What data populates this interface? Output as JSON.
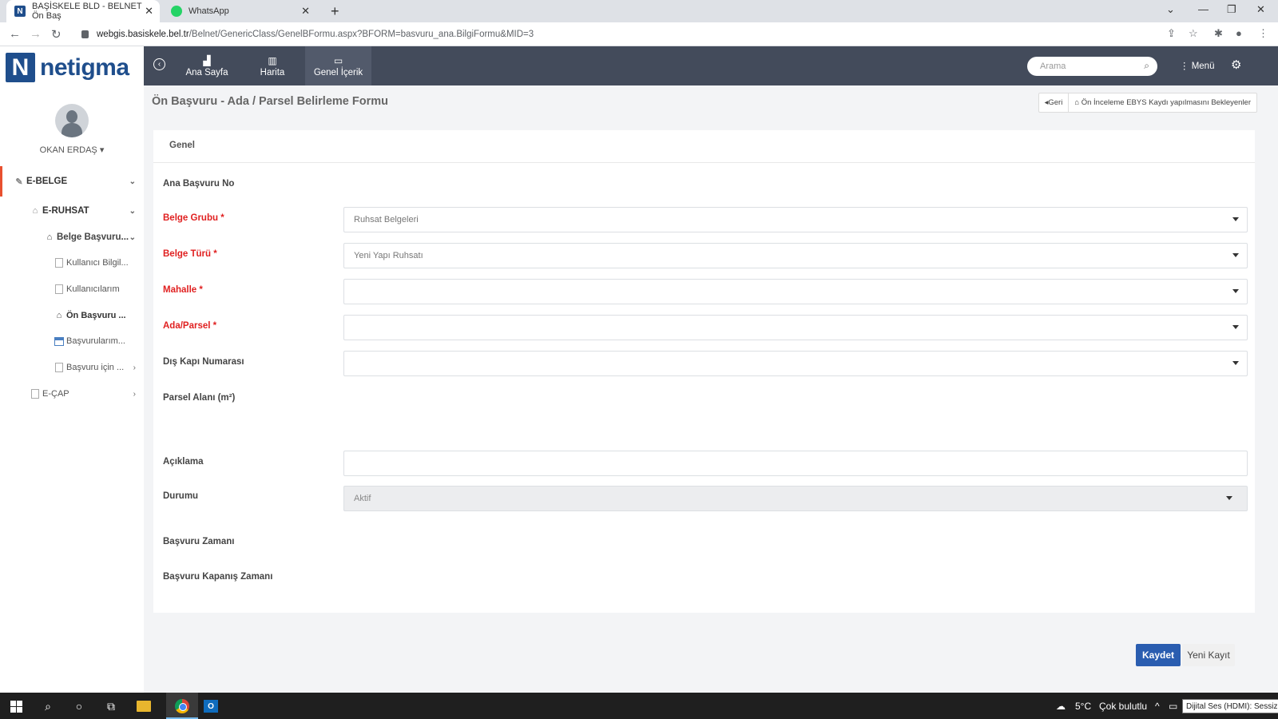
{
  "browser": {
    "tabs": [
      {
        "title": "BAŞİSKELE BLD - BELNET Ön Baş",
        "active": true
      },
      {
        "title": "WhatsApp",
        "active": false
      }
    ],
    "url_host": "webgis.basiskele.bel.tr",
    "url_path": "/Belnet/GenericClass/GenelBFormu.aspx?BFORM=basvuru_ana.BilgiFormu&MID=3"
  },
  "sidebar": {
    "logo_text": "netigma",
    "logo_mark": "N",
    "user_name": "OKAN ERDAŞ",
    "items": [
      {
        "label": "E-BELGE"
      },
      {
        "label": "E-RUHSAT"
      },
      {
        "label": "Belge Başvuru..."
      },
      {
        "label": "Kullanıcı Bilgil..."
      },
      {
        "label": "Kullanıcılarım"
      },
      {
        "label": "Ön Başvuru ..."
      },
      {
        "label": "Başvurularım..."
      },
      {
        "label": "Başvuru için ..."
      },
      {
        "label": "E-ÇAP"
      }
    ]
  },
  "topnav": {
    "items": [
      {
        "label": "Ana Sayfa"
      },
      {
        "label": "Harita"
      },
      {
        "label": "Genel İçerik"
      }
    ],
    "search_placeholder": "Arama",
    "menu_label": "Menü"
  },
  "page": {
    "title": "Ön Başvuru - Ada / Parsel Belirleme Formu",
    "back_label": "Geri",
    "breadcrumb_label": "Ön İnceleme EBYS Kaydı yapılmasını Bekleyenler",
    "tab_label": "Genel"
  },
  "form": {
    "ana_basvuru_no": {
      "label": "Ana Başvuru No"
    },
    "belge_grubu": {
      "label": "Belge Grubu *",
      "value": "Ruhsat Belgeleri"
    },
    "belge_turu": {
      "label": "Belge Türü *",
      "value": "Yeni Yapı Ruhsatı"
    },
    "mahalle": {
      "label": "Mahalle *",
      "value": ""
    },
    "ada_parsel": {
      "label": "Ada/Parsel *",
      "value": ""
    },
    "dis_kapi": {
      "label": "Dış Kapı Numarası",
      "value": ""
    },
    "parsel_alani": {
      "label": "Parsel Alanı (m²)"
    },
    "aciklama": {
      "label": "Açıklama",
      "value": ""
    },
    "durumu": {
      "label": "Durumu",
      "value": "Aktif"
    },
    "basvuru_zamani": {
      "label": "Başvuru Zamanı"
    },
    "basvuru_kapanis": {
      "label": "Başvuru Kapanış Zamanı"
    }
  },
  "actions": {
    "save": "Kaydet",
    "new": "Yeni Kayıt"
  },
  "taskbar": {
    "weather": "5°C",
    "weather_desc": "Çok bulutlu",
    "tooltip": "Dijital Ses (HDMI): Sessiz"
  },
  "colors": {
    "navbar": "#434b5b",
    "brand": "#1f4e8c",
    "required": "#e02020",
    "primary_button": "#2a5db0",
    "active_accent": "#e8502f"
  }
}
